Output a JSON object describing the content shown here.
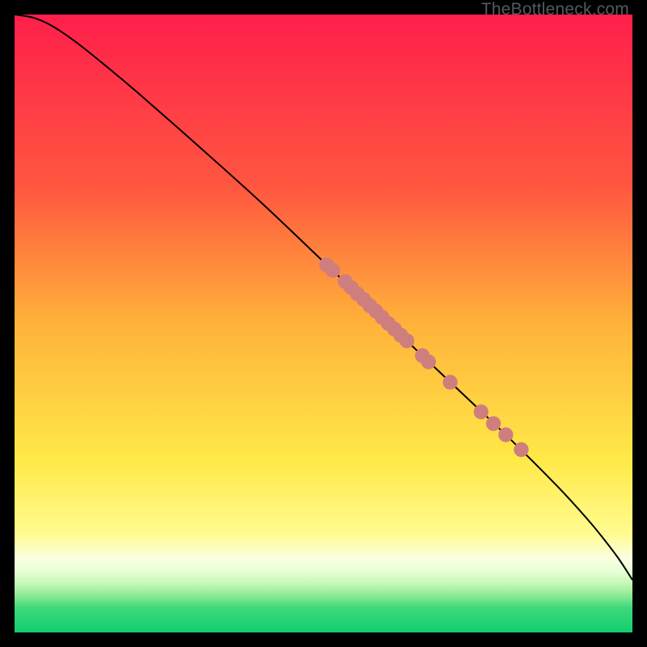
{
  "watermark": "TheBottleneck.com",
  "chart_data": {
    "type": "line",
    "title": "",
    "xlabel": "",
    "ylabel": "",
    "xlim": [
      0,
      100
    ],
    "ylim": [
      0,
      100
    ],
    "background_gradient_stops": [
      {
        "offset": 0,
        "color": "#ff1f4b"
      },
      {
        "offset": 28,
        "color": "#ff5740"
      },
      {
        "offset": 50,
        "color": "#ffb23a"
      },
      {
        "offset": 72,
        "color": "#ffe947"
      },
      {
        "offset": 84,
        "color": "#fffb8f"
      },
      {
        "offset": 88,
        "color": "#fbffe0"
      },
      {
        "offset": 90,
        "color": "#e8ffd8"
      },
      {
        "offset": 92,
        "color": "#c8f8b8"
      },
      {
        "offset": 94,
        "color": "#8ee994"
      },
      {
        "offset": 96,
        "color": "#3ed97b"
      },
      {
        "offset": 100,
        "color": "#11ce6e"
      }
    ],
    "curve": [
      {
        "x": 0,
        "y": 100
      },
      {
        "x": 3,
        "y": 99.5
      },
      {
        "x": 6,
        "y": 98.2
      },
      {
        "x": 10,
        "y": 95.5
      },
      {
        "x": 15,
        "y": 91.5
      },
      {
        "x": 20,
        "y": 87.3
      },
      {
        "x": 30,
        "y": 78.5
      },
      {
        "x": 40,
        "y": 69.5
      },
      {
        "x": 50,
        "y": 60.0
      },
      {
        "x": 60,
        "y": 50.5
      },
      {
        "x": 70,
        "y": 41.0
      },
      {
        "x": 80,
        "y": 31.5
      },
      {
        "x": 88,
        "y": 23.5
      },
      {
        "x": 93,
        "y": 18.0
      },
      {
        "x": 96,
        "y": 14.3
      },
      {
        "x": 98,
        "y": 11.6
      },
      {
        "x": 100,
        "y": 8.5
      }
    ],
    "markers": [
      {
        "x": 50.5,
        "y": 59.5
      },
      {
        "x": 51.5,
        "y": 58.6
      },
      {
        "x": 53.5,
        "y": 56.8
      },
      {
        "x": 54.5,
        "y": 55.8
      },
      {
        "x": 55.5,
        "y": 54.8
      },
      {
        "x": 56.5,
        "y": 53.9
      },
      {
        "x": 57.5,
        "y": 52.9
      },
      {
        "x": 58.5,
        "y": 52.0
      },
      {
        "x": 59.5,
        "y": 51.0
      },
      {
        "x": 60.5,
        "y": 50.0
      },
      {
        "x": 61.5,
        "y": 49.1
      },
      {
        "x": 62.5,
        "y": 48.1
      },
      {
        "x": 63.5,
        "y": 47.2
      },
      {
        "x": 66.0,
        "y": 44.8
      },
      {
        "x": 67.0,
        "y": 43.8
      },
      {
        "x": 70.5,
        "y": 40.5
      },
      {
        "x": 75.5,
        "y": 35.7
      },
      {
        "x": 77.5,
        "y": 33.8
      },
      {
        "x": 79.5,
        "y": 32.0
      },
      {
        "x": 82.0,
        "y": 29.6
      }
    ],
    "marker_color": "#cf7e7e",
    "marker_radius": 1.2,
    "curve_color": "#000000",
    "curve_width": 0.28
  }
}
